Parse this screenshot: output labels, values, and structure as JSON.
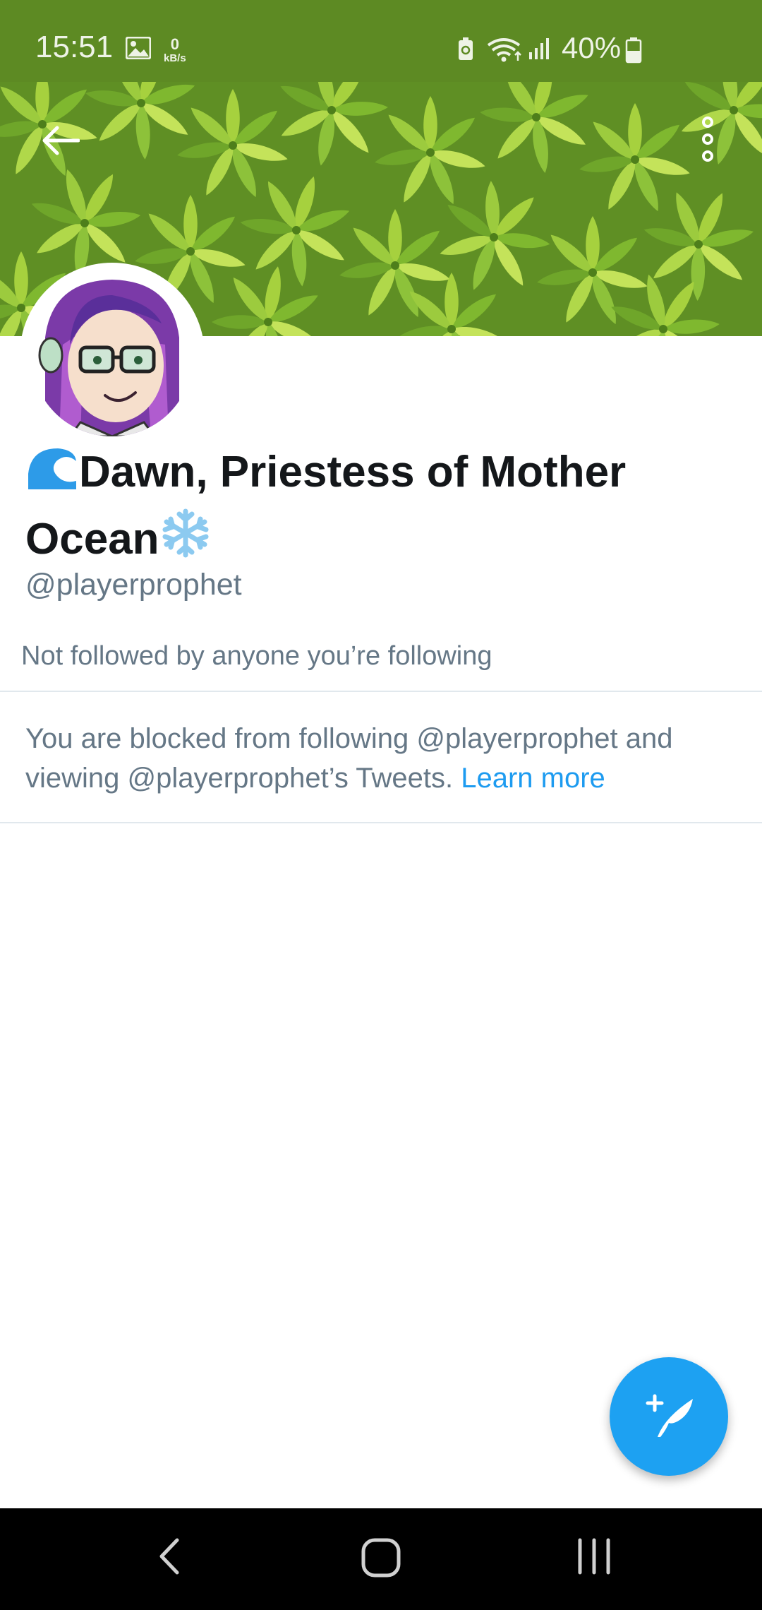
{
  "status_bar": {
    "time": "15:51",
    "network_speed_value": "0",
    "network_speed_unit": "kB/s",
    "battery_percent": "40%",
    "icons": [
      "gallery-icon",
      "battery-saver-icon",
      "wifi-icon",
      "signal-icon",
      "battery-icon"
    ]
  },
  "header": {
    "back_icon": "arrow-left-icon",
    "more_icon": "more-vertical-icon"
  },
  "profile": {
    "name_emoji_left": "wave-emoji",
    "name_line1": "Dawn, Priestess of Mother",
    "name_line2": "Ocean",
    "name_emoji_right": "snowflake-emoji",
    "handle": "@playerprophet",
    "followed_by": "Not followed by anyone you’re following"
  },
  "blocked_notice": {
    "text": "You are blocked from following @playerprophet and viewing @playerprophet’s Tweets.",
    "link": "Learn more"
  },
  "fab": {
    "icon": "compose-tweet-icon"
  },
  "nav_bar": {
    "icons": [
      "nav-back-icon",
      "nav-home-icon",
      "nav-recents-icon"
    ]
  },
  "colors": {
    "status_bar": "#5d8a23",
    "link": "#1d9bf0",
    "fab": "#1da1f2",
    "secondary_text": "#657786",
    "primary_text": "#14171a"
  }
}
